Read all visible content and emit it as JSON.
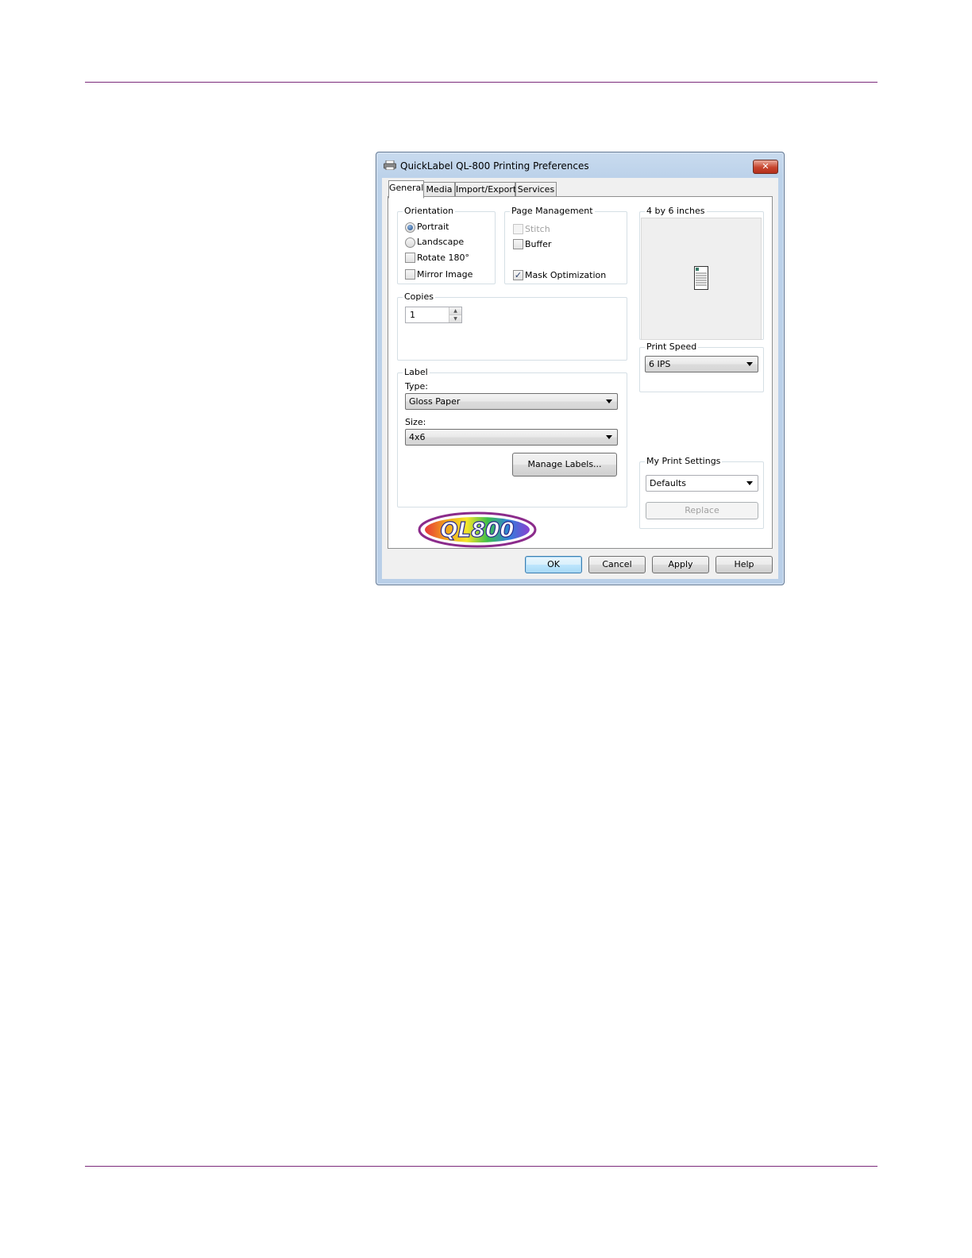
{
  "window": {
    "title": "QuickLabel QL-800 Printing Preferences",
    "close_glyph": "✕"
  },
  "tabs": [
    {
      "label": "General",
      "active": true
    },
    {
      "label": "Media"
    },
    {
      "label": "Import/Export"
    },
    {
      "label": "Services"
    }
  ],
  "orientation": {
    "title": "Orientation",
    "portrait": "Portrait",
    "landscape": "Landscape",
    "rotate": "Rotate 180°",
    "mirror": "Mirror Image",
    "selected": "Portrait"
  },
  "page_management": {
    "title": "Page Management",
    "stitch": "Stitch",
    "buffer": "Buffer",
    "mask": "Mask Optimization",
    "check_glyph": "✓"
  },
  "copies": {
    "title": "Copies",
    "value": "1",
    "up_glyph": "▲",
    "down_glyph": "▼"
  },
  "label": {
    "title": "Label",
    "type_label": "Type:",
    "type_value": "Gloss Paper",
    "size_label": "Size:",
    "size_value": "4x6",
    "manage_button": "Manage Labels..."
  },
  "preview": {
    "title": "4 by 6 inches",
    "icon": "document-icon"
  },
  "print_speed": {
    "title": "Print Speed",
    "value": "6 IPS"
  },
  "my_print_settings": {
    "title": "My Print Settings",
    "value": "Defaults",
    "replace_button": "Replace"
  },
  "logo_text": "QL800",
  "footer_buttons": {
    "ok": "OK",
    "cancel": "Cancel",
    "apply": "Apply",
    "help": "Help"
  },
  "colors": {
    "rule": "#7b2a7b",
    "window_frame": "#bcd2ea",
    "default_button": "#3c7fb1"
  }
}
